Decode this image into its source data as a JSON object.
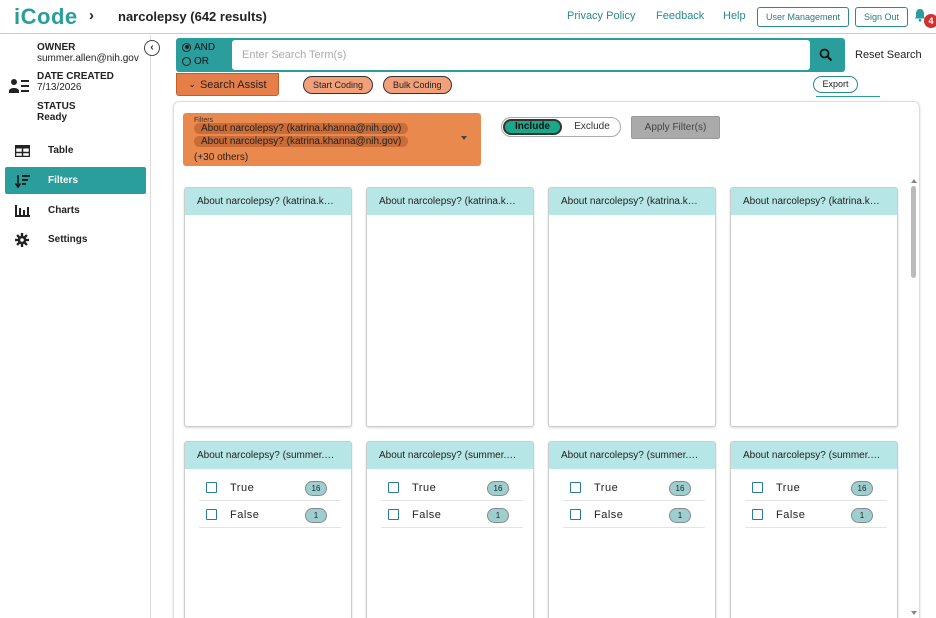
{
  "app": {
    "logo_text": "iCode",
    "brand_color": "#2a9d9d"
  },
  "header": {
    "title": "narcolepsy (642 results)",
    "links": [
      "Privacy Policy",
      "Feedback",
      "Help"
    ],
    "buttons": {
      "user_management": "User Management",
      "sign_out": "Sign Out"
    },
    "notification_count": "4"
  },
  "sidebar": {
    "owner_label": "OWNER",
    "owner_value": "summer.allen@nih.gov",
    "date_label": "DATE CREATED",
    "date_value": "7/13/2026",
    "status_label": "STATUS",
    "status_value": "Ready",
    "nav": [
      {
        "label": "Table",
        "icon": "table-icon"
      },
      {
        "label": "Filters",
        "icon": "filter-icon",
        "active": true
      },
      {
        "label": "Charts",
        "icon": "bar-chart-icon"
      },
      {
        "label": "Settings",
        "icon": "gear-icon"
      }
    ]
  },
  "search": {
    "and_label": "AND",
    "or_label": "OR",
    "selected": "AND",
    "placeholder": "Enter Search Term(s)",
    "value": "",
    "reset_label": "Reset Search"
  },
  "actions": {
    "search_assist": "Search Assist",
    "start_coding": "Start Coding",
    "bulk_coding": "Bulk Coding",
    "export": "Export"
  },
  "filters": {
    "label": "Filters",
    "chips": [
      "About narcolepsy? (katrina.khanna@nih.gov)",
      "About narcolepsy? (katrina.khanna@nih.gov)"
    ],
    "others": "(+30 others)",
    "include": "Include",
    "exclude": "Exclude",
    "mode": "Include",
    "apply": "Apply Filter(s)"
  },
  "cards_row1": [
    {
      "title": "About narcolepsy? (katrina.khanna@nih.gov)"
    },
    {
      "title": "About narcolepsy? (katrina.khanna@nih.gov)"
    },
    {
      "title": "About narcolepsy? (katrina.khanna@nih.gov)"
    },
    {
      "title": "About narcolepsy? (katrina.khanna@nih.gov)"
    }
  ],
  "cards_row2": [
    {
      "title": "About narcolepsy? (summer.allen@nih.gov)",
      "options": [
        {
          "label": "True",
          "count": "16"
        },
        {
          "label": "False",
          "count": "1"
        }
      ]
    },
    {
      "title": "About narcolepsy? (summer.allen@nih.gov)",
      "options": [
        {
          "label": "True",
          "count": "16"
        },
        {
          "label": "False",
          "count": "1"
        }
      ]
    },
    {
      "title": "About narcolepsy? (summer.allen@nih.gov)",
      "options": [
        {
          "label": "True",
          "count": "16"
        },
        {
          "label": "False",
          "count": "1"
        }
      ]
    },
    {
      "title": "About narcolepsy? (summer.allen@nih.gov)",
      "options": [
        {
          "label": "True",
          "count": "16"
        },
        {
          "label": "False",
          "count": "1"
        }
      ]
    }
  ],
  "colors": {
    "teal": "#2a9d9d",
    "orange": "#e9894d",
    "card_header": "#b6e6e6",
    "include": "#1aa88a",
    "badge": "#d32f2f"
  }
}
